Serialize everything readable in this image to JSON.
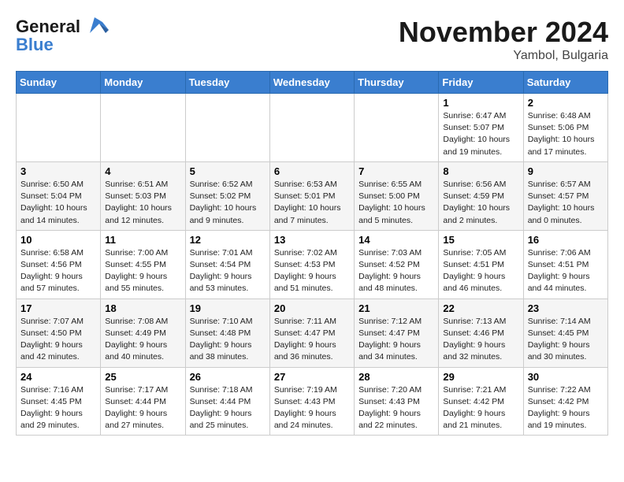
{
  "header": {
    "logo_line1": "General",
    "logo_line2": "Blue",
    "month": "November 2024",
    "location": "Yambol, Bulgaria"
  },
  "weekdays": [
    "Sunday",
    "Monday",
    "Tuesday",
    "Wednesday",
    "Thursday",
    "Friday",
    "Saturday"
  ],
  "weeks": [
    [
      {
        "day": "",
        "info": ""
      },
      {
        "day": "",
        "info": ""
      },
      {
        "day": "",
        "info": ""
      },
      {
        "day": "",
        "info": ""
      },
      {
        "day": "",
        "info": ""
      },
      {
        "day": "1",
        "info": "Sunrise: 6:47 AM\nSunset: 5:07 PM\nDaylight: 10 hours\nand 19 minutes."
      },
      {
        "day": "2",
        "info": "Sunrise: 6:48 AM\nSunset: 5:06 PM\nDaylight: 10 hours\nand 17 minutes."
      }
    ],
    [
      {
        "day": "3",
        "info": "Sunrise: 6:50 AM\nSunset: 5:04 PM\nDaylight: 10 hours\nand 14 minutes."
      },
      {
        "day": "4",
        "info": "Sunrise: 6:51 AM\nSunset: 5:03 PM\nDaylight: 10 hours\nand 12 minutes."
      },
      {
        "day": "5",
        "info": "Sunrise: 6:52 AM\nSunset: 5:02 PM\nDaylight: 10 hours\nand 9 minutes."
      },
      {
        "day": "6",
        "info": "Sunrise: 6:53 AM\nSunset: 5:01 PM\nDaylight: 10 hours\nand 7 minutes."
      },
      {
        "day": "7",
        "info": "Sunrise: 6:55 AM\nSunset: 5:00 PM\nDaylight: 10 hours\nand 5 minutes."
      },
      {
        "day": "8",
        "info": "Sunrise: 6:56 AM\nSunset: 4:59 PM\nDaylight: 10 hours\nand 2 minutes."
      },
      {
        "day": "9",
        "info": "Sunrise: 6:57 AM\nSunset: 4:57 PM\nDaylight: 10 hours\nand 0 minutes."
      }
    ],
    [
      {
        "day": "10",
        "info": "Sunrise: 6:58 AM\nSunset: 4:56 PM\nDaylight: 9 hours\nand 57 minutes."
      },
      {
        "day": "11",
        "info": "Sunrise: 7:00 AM\nSunset: 4:55 PM\nDaylight: 9 hours\nand 55 minutes."
      },
      {
        "day": "12",
        "info": "Sunrise: 7:01 AM\nSunset: 4:54 PM\nDaylight: 9 hours\nand 53 minutes."
      },
      {
        "day": "13",
        "info": "Sunrise: 7:02 AM\nSunset: 4:53 PM\nDaylight: 9 hours\nand 51 minutes."
      },
      {
        "day": "14",
        "info": "Sunrise: 7:03 AM\nSunset: 4:52 PM\nDaylight: 9 hours\nand 48 minutes."
      },
      {
        "day": "15",
        "info": "Sunrise: 7:05 AM\nSunset: 4:51 PM\nDaylight: 9 hours\nand 46 minutes."
      },
      {
        "day": "16",
        "info": "Sunrise: 7:06 AM\nSunset: 4:51 PM\nDaylight: 9 hours\nand 44 minutes."
      }
    ],
    [
      {
        "day": "17",
        "info": "Sunrise: 7:07 AM\nSunset: 4:50 PM\nDaylight: 9 hours\nand 42 minutes."
      },
      {
        "day": "18",
        "info": "Sunrise: 7:08 AM\nSunset: 4:49 PM\nDaylight: 9 hours\nand 40 minutes."
      },
      {
        "day": "19",
        "info": "Sunrise: 7:10 AM\nSunset: 4:48 PM\nDaylight: 9 hours\nand 38 minutes."
      },
      {
        "day": "20",
        "info": "Sunrise: 7:11 AM\nSunset: 4:47 PM\nDaylight: 9 hours\nand 36 minutes."
      },
      {
        "day": "21",
        "info": "Sunrise: 7:12 AM\nSunset: 4:47 PM\nDaylight: 9 hours\nand 34 minutes."
      },
      {
        "day": "22",
        "info": "Sunrise: 7:13 AM\nSunset: 4:46 PM\nDaylight: 9 hours\nand 32 minutes."
      },
      {
        "day": "23",
        "info": "Sunrise: 7:14 AM\nSunset: 4:45 PM\nDaylight: 9 hours\nand 30 minutes."
      }
    ],
    [
      {
        "day": "24",
        "info": "Sunrise: 7:16 AM\nSunset: 4:45 PM\nDaylight: 9 hours\nand 29 minutes."
      },
      {
        "day": "25",
        "info": "Sunrise: 7:17 AM\nSunset: 4:44 PM\nDaylight: 9 hours\nand 27 minutes."
      },
      {
        "day": "26",
        "info": "Sunrise: 7:18 AM\nSunset: 4:44 PM\nDaylight: 9 hours\nand 25 minutes."
      },
      {
        "day": "27",
        "info": "Sunrise: 7:19 AM\nSunset: 4:43 PM\nDaylight: 9 hours\nand 24 minutes."
      },
      {
        "day": "28",
        "info": "Sunrise: 7:20 AM\nSunset: 4:43 PM\nDaylight: 9 hours\nand 22 minutes."
      },
      {
        "day": "29",
        "info": "Sunrise: 7:21 AM\nSunset: 4:42 PM\nDaylight: 9 hours\nand 21 minutes."
      },
      {
        "day": "30",
        "info": "Sunrise: 7:22 AM\nSunset: 4:42 PM\nDaylight: 9 hours\nand 19 minutes."
      }
    ]
  ]
}
